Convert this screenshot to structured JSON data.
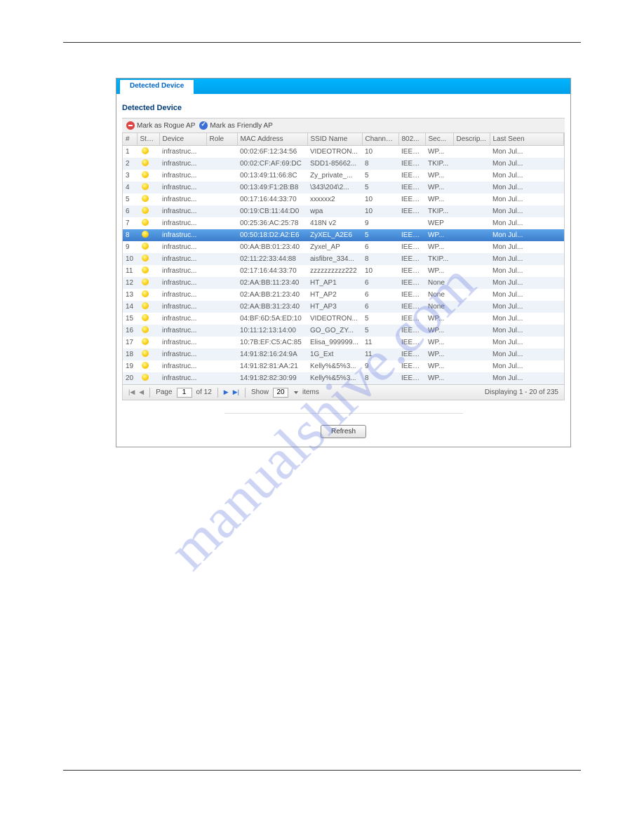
{
  "watermark": "manualshive.com",
  "tab": {
    "label": "Detected Device"
  },
  "section": {
    "title": "Detected Device"
  },
  "toolbar": {
    "rogue_label": "Mark as Rogue AP",
    "friendly_label": "Mark as Friendly AP"
  },
  "columns": {
    "idx": "#",
    "status": "Stat...",
    "device": "Device",
    "role": "Role",
    "mac": "MAC Address",
    "ssid": "SSID Name",
    "channel": "Channe...",
    "std": "802...",
    "sec": "Sec...",
    "descr": "Descrip...",
    "last": "Last Seen"
  },
  "selected_row": 8,
  "rows": [
    {
      "idx": "1",
      "device": "infrastruc...",
      "mac": "00:02:6F:12:34:56",
      "ssid": "VIDEOTRON...",
      "ch": "10",
      "std": "IEEE...",
      "sec": "WP...",
      "last": "Mon Jul..."
    },
    {
      "idx": "2",
      "device": "infrastruc...",
      "mac": "00:02:CF:AF:69:DC",
      "ssid": "SDD1-85662...",
      "ch": "8",
      "std": "IEEE...",
      "sec": "TKIP...",
      "last": "Mon Jul..."
    },
    {
      "idx": "3",
      "device": "infrastruc...",
      "mac": "00:13:49:11:66:8C",
      "ssid": "Zy_private_...",
      "ch": "5",
      "std": "IEEE...",
      "sec": "WP...",
      "last": "Mon Jul..."
    },
    {
      "idx": "4",
      "device": "infrastruc...",
      "mac": "00:13:49:F1:2B:B8",
      "ssid": "\\343\\204\\2...",
      "ch": "5",
      "std": "IEEE...",
      "sec": "WP...",
      "last": "Mon Jul..."
    },
    {
      "idx": "5",
      "device": "infrastruc...",
      "mac": "00:17:16:44:33:70",
      "ssid": "xxxxxx2",
      "ch": "10",
      "std": "IEEE...",
      "sec": "WP...",
      "last": "Mon Jul..."
    },
    {
      "idx": "6",
      "device": "infrastruc...",
      "mac": "00:19:CB:11:44:D0",
      "ssid": "wpa",
      "ch": "10",
      "std": "IEEE...",
      "sec": "TKIP...",
      "last": "Mon Jul..."
    },
    {
      "idx": "7",
      "device": "infrastruc...",
      "mac": "00:25:36:AC:25:78",
      "ssid": "418N v2",
      "ch": "9",
      "std": "",
      "sec": "WEP",
      "last": "Mon Jul..."
    },
    {
      "idx": "8",
      "device": "infrastruc...",
      "mac": "00:50:18:D2:A2:E6",
      "ssid": "ZyXEL_A2E6",
      "ch": "5",
      "std": "IEEE...",
      "sec": "WP...",
      "last": "Mon Jul..."
    },
    {
      "idx": "9",
      "device": "infrastruc...",
      "mac": "00:AA:BB:01:23:40",
      "ssid": "Zyxel_AP",
      "ch": "6",
      "std": "IEEE...",
      "sec": "WP...",
      "last": "Mon Jul..."
    },
    {
      "idx": "10",
      "device": "infrastruc...",
      "mac": "02:11:22:33:44:88",
      "ssid": "aisfibre_334...",
      "ch": "8",
      "std": "IEEE...",
      "sec": "TKIP...",
      "last": "Mon Jul..."
    },
    {
      "idx": "11",
      "device": "infrastruc...",
      "mac": "02:17:16:44:33:70",
      "ssid": "zzzzzzzzzz222",
      "ch": "10",
      "std": "IEEE...",
      "sec": "WP...",
      "last": "Mon Jul..."
    },
    {
      "idx": "12",
      "device": "infrastruc...",
      "mac": "02:AA:BB:11:23:40",
      "ssid": "HT_AP1",
      "ch": "6",
      "std": "IEEE...",
      "sec": "None",
      "last": "Mon Jul..."
    },
    {
      "idx": "13",
      "device": "infrastruc...",
      "mac": "02:AA:BB:21:23:40",
      "ssid": "HT_AP2",
      "ch": "6",
      "std": "IEEE...",
      "sec": "None",
      "last": "Mon Jul..."
    },
    {
      "idx": "14",
      "device": "infrastruc...",
      "mac": "02:AA:BB:31:23:40",
      "ssid": "HT_AP3",
      "ch": "6",
      "std": "IEEE...",
      "sec": "None",
      "last": "Mon Jul..."
    },
    {
      "idx": "15",
      "device": "infrastruc...",
      "mac": "04:BF:6D:5A:ED:10",
      "ssid": "VIDEOTRON...",
      "ch": "5",
      "std": "IEEE...",
      "sec": "WP...",
      "last": "Mon Jul..."
    },
    {
      "idx": "16",
      "device": "infrastruc...",
      "mac": "10:11:12:13:14:00",
      "ssid": "GO_GO_ZY...",
      "ch": "5",
      "std": "IEEE...",
      "sec": "WP...",
      "last": "Mon Jul..."
    },
    {
      "idx": "17",
      "device": "infrastruc...",
      "mac": "10:7B:EF:C5:AC:85",
      "ssid": "Elisa_999999...",
      "ch": "11",
      "std": "IEEE...",
      "sec": "WP...",
      "last": "Mon Jul..."
    },
    {
      "idx": "18",
      "device": "infrastruc...",
      "mac": "14:91:82:16:24:9A",
      "ssid": "1G_Ext",
      "ch": "11",
      "std": "IEEE...",
      "sec": "WP...",
      "last": "Mon Jul..."
    },
    {
      "idx": "19",
      "device": "infrastruc...",
      "mac": "14:91:82:81:AA:21",
      "ssid": "Kelly%&5%3...",
      "ch": "9",
      "std": "IEEE...",
      "sec": "WP...",
      "last": "Mon Jul..."
    },
    {
      "idx": "20",
      "device": "infrastruc...",
      "mac": "14:91:82:82:30:99",
      "ssid": "Kelly%&5%3...",
      "ch": "8",
      "std": "IEEE...",
      "sec": "WP...",
      "last": "Mon Jul..."
    }
  ],
  "pager": {
    "page_label": "Page",
    "page_value": "1",
    "of_label": "of 12",
    "show_label": "Show",
    "show_value": "20",
    "items_label": "items",
    "display_text": "Displaying 1 - 20 of 235"
  },
  "refresh": {
    "label": "Refresh"
  }
}
